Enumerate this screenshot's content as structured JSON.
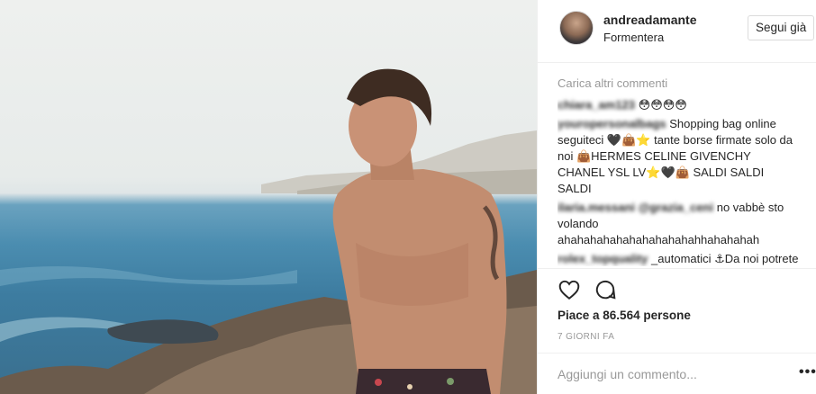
{
  "post": {
    "username": "andreadamante",
    "location": "Formentera",
    "follow_label": "Segui già",
    "photo_icon": "beach-portrait-photo"
  },
  "comments": {
    "load_more": "Carica altri commenti",
    "items": [
      {
        "user": "chiara_am123",
        "text": "😳😳😳😳"
      },
      {
        "user": "youropersonalbags",
        "text": "Shopping bag online seguiteci 🖤👜⭐ tante borse firmate solo da noi 👜HERMES CELINE GIVENCHY CHANEL YSL LV⭐🖤👜 SALDI SALDI SALDI"
      },
      {
        "user": "ilaria.messani @grazia_ceni",
        "text": "no vabbè sto volando ahahahahahahahahahahahhahahahah"
      },
      {
        "user": "rolex_topquality",
        "text": "_automatici ⚓Da noi potrete trovare repliche di OROLOGI⚓"
      }
    ]
  },
  "actions": {
    "like_icon": "heart-icon",
    "comment_icon": "comment-icon",
    "likes_text": "Piace a 86.564 persone",
    "date_text": "7 GIORNI FA"
  },
  "footer": {
    "comment_placeholder": "Aggiungi un commento...",
    "more_label": "•••"
  },
  "colors": {
    "border": "#dbdbdb",
    "muted": "#999999",
    "text": "#262626"
  }
}
